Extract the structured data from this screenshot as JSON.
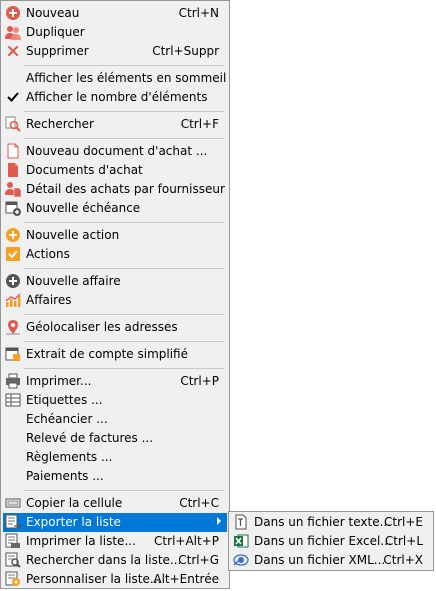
{
  "menu": {
    "items": [
      {
        "label": "Nouveau",
        "shortcut": "Ctrl+N",
        "icon": "add-icon"
      },
      {
        "label": "Dupliquer",
        "shortcut": "",
        "icon": "duplicate-users-icon"
      },
      {
        "label": "Supprimer",
        "shortcut": "Ctrl+Suppr",
        "icon": "delete-icon"
      },
      {
        "label": "Afficher les éléments en sommeil",
        "shortcut": "",
        "icon": ""
      },
      {
        "label": "Afficher le nombre d'éléments",
        "shortcut": "",
        "icon": "checkmark-icon"
      },
      {
        "label": "Rechercher",
        "shortcut": "Ctrl+F",
        "icon": "search-icon"
      },
      {
        "label": "Nouveau document d'achat ...",
        "shortcut": "",
        "icon": "new-document-icon"
      },
      {
        "label": "Documents d'achat",
        "shortcut": "",
        "icon": "documents-icon"
      },
      {
        "label": "Détail des achats par fournisseur",
        "shortcut": "",
        "icon": "supplier-detail-icon"
      },
      {
        "label": "Nouvelle échéance",
        "shortcut": "",
        "icon": "calendar-add-icon"
      },
      {
        "label": "Nouvelle action",
        "shortcut": "",
        "icon": "add-action-icon"
      },
      {
        "label": "Actions",
        "shortcut": "",
        "icon": "actions-check-icon"
      },
      {
        "label": "Nouvelle affaire",
        "shortcut": "",
        "icon": "add-affair-icon"
      },
      {
        "label": "Affaires",
        "shortcut": "",
        "icon": "chart-icon"
      },
      {
        "label": "Géolocaliser les adresses",
        "shortcut": "",
        "icon": "map-pin-icon"
      },
      {
        "label": "Extrait de compte simplifié",
        "shortcut": "",
        "icon": "account-statement-icon"
      },
      {
        "label": "Imprimer...",
        "shortcut": "Ctrl+P",
        "icon": "printer-icon"
      },
      {
        "label": "Etiquettes ...",
        "shortcut": "",
        "icon": "labels-grid-icon"
      },
      {
        "label": "Echéancier ...",
        "shortcut": "",
        "icon": ""
      },
      {
        "label": "Relevé de factures ...",
        "shortcut": "",
        "icon": ""
      },
      {
        "label": "Règlements ...",
        "shortcut": "",
        "icon": ""
      },
      {
        "label": "Paiements ...",
        "shortcut": "",
        "icon": ""
      },
      {
        "label": "Copier la cellule",
        "shortcut": "Ctrl+C",
        "icon": "copy-cell-icon"
      },
      {
        "label": "Exporter la liste",
        "shortcut": "",
        "icon": "export-list-icon"
      },
      {
        "label": "Imprimer la liste...",
        "shortcut": "Ctrl+Alt+P",
        "icon": "print-list-icon"
      },
      {
        "label": "Rechercher dans la liste...",
        "shortcut": "Ctrl+G",
        "icon": "search-list-icon"
      },
      {
        "label": "Personnaliser la liste...",
        "shortcut": "Alt+Entrée",
        "icon": "customize-list-icon"
      }
    ]
  },
  "submenu": {
    "items": [
      {
        "label": "Dans un fichier texte...",
        "shortcut": "Ctrl+E",
        "icon": "text-file-icon"
      },
      {
        "label": "Dans un fichier Excel...",
        "shortcut": "Ctrl+L",
        "icon": "excel-file-icon"
      },
      {
        "label": "Dans un fichier XML...",
        "shortcut": "Ctrl+X",
        "icon": "xml-file-icon"
      }
    ]
  },
  "colors": {
    "highlight": "#0078d7",
    "menu_bg": "#f0f0f0",
    "accent_orange": "#f5a020",
    "accent_red": "#e05a4e"
  }
}
